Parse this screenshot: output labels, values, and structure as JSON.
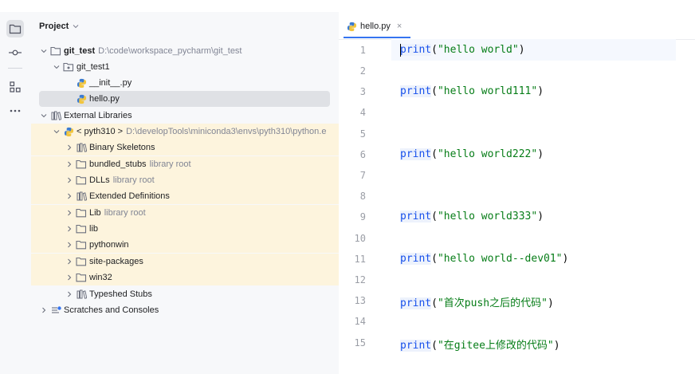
{
  "toolwindow": {
    "title": "Project"
  },
  "tree": [
    {
      "name": "git_test",
      "path": "D:\\code\\workspace_pycharm\\git_test"
    },
    {
      "name": "git_test1"
    },
    {
      "name": "__init__.py"
    },
    {
      "name": "hello.py"
    },
    {
      "name": "External Libraries"
    },
    {
      "name": "< pyth310 >",
      "path": "D:\\developTools\\miniconda3\\envs\\pyth310\\python.e"
    },
    {
      "name": "Binary Skeletons"
    },
    {
      "name": "bundled_stubs",
      "hint": "library root"
    },
    {
      "name": "DLLs",
      "hint": "library root"
    },
    {
      "name": "Extended Definitions"
    },
    {
      "name": "Lib",
      "hint": "library root"
    },
    {
      "name": "lib"
    },
    {
      "name": "pythonwin"
    },
    {
      "name": "site-packages"
    },
    {
      "name": "win32"
    },
    {
      "name": "Typeshed Stubs"
    },
    {
      "name": "Scratches and Consoles"
    }
  ],
  "editor": {
    "tab_label": "hello.py",
    "tab_close": "×",
    "line_numbers": [
      "1",
      "2",
      "3",
      "4",
      "5",
      "6",
      "7",
      "8",
      "9",
      "10",
      "11",
      "12",
      "13",
      "14",
      "15"
    ],
    "code": [
      {
        "fn": "print",
        "open": "(",
        "str": "\"hello world\"",
        "close": ")"
      },
      {
        "fn": "print",
        "open": "(",
        "str": "\"hello world111\"",
        "close": ")"
      },
      {
        "fn": "print",
        "open": "(",
        "str": "\"hello world222\"",
        "close": ")"
      },
      {
        "fn": "print",
        "open": "(",
        "str": "\"hello world333\"",
        "close": ")"
      },
      {
        "fn": "print",
        "open": "(",
        "str": "\"hello world--dev01\"",
        "close": ")"
      },
      {
        "fn": "print",
        "open": "(",
        "str": "\"首次push之后的代码\"",
        "close": ")"
      },
      {
        "fn": "print",
        "open": "(",
        "str": "\"在gitee上修改的代码\"",
        "close": ")"
      }
    ]
  },
  "colors": {
    "accent": "#3574f0",
    "library_bg": "#fdf4dd",
    "string": "#067d17",
    "function": "#1750eb"
  },
  "icons": [
    "folder-icon",
    "commit-icon",
    "structure-icon",
    "more-icon",
    "python-file-icon",
    "library-icon",
    "scratches-icon"
  ]
}
